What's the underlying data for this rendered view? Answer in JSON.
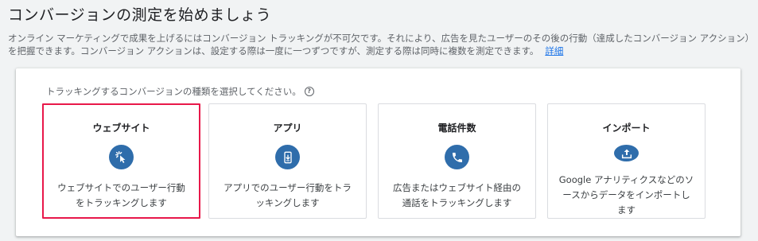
{
  "header": {
    "title": "コンバージョンの測定を始めましょう",
    "description": "オンライン マーケティングで成果を上げるにはコンバージョン トラッキングが不可欠です。それにより、広告を見たユーザーのその後の行動（達成したコンバージョン アクション）を把握できます。コンバージョン アクションは、設定する際は一度に一つずつですが、測定する際は同時に複数を測定できます。",
    "learn_more": "詳細"
  },
  "selector": {
    "prompt": "トラッキングするコンバージョンの種類を選択してください。",
    "help_glyph": "?",
    "options": [
      {
        "title": "ウェブサイト",
        "icon": "cursor-click-icon",
        "description": "ウェブサイトでのユーザー行動をトラッキングします",
        "selected": true
      },
      {
        "title": "アプリ",
        "icon": "phone-download-icon",
        "description": "アプリでのユーザー行動をトラッキングします",
        "selected": false
      },
      {
        "title": "電話件数",
        "icon": "phone-icon",
        "description": "広告またはウェブサイト経由の通話をトラッキングします",
        "selected": false
      },
      {
        "title": "インポート",
        "icon": "upload-icon",
        "description": "Google アナリティクスなどのソースからデータをインポートします",
        "selected": false
      }
    ]
  },
  "colors": {
    "accent": "#2f6dab",
    "link": "#1a73e8",
    "selected_border": "#e8184a"
  }
}
